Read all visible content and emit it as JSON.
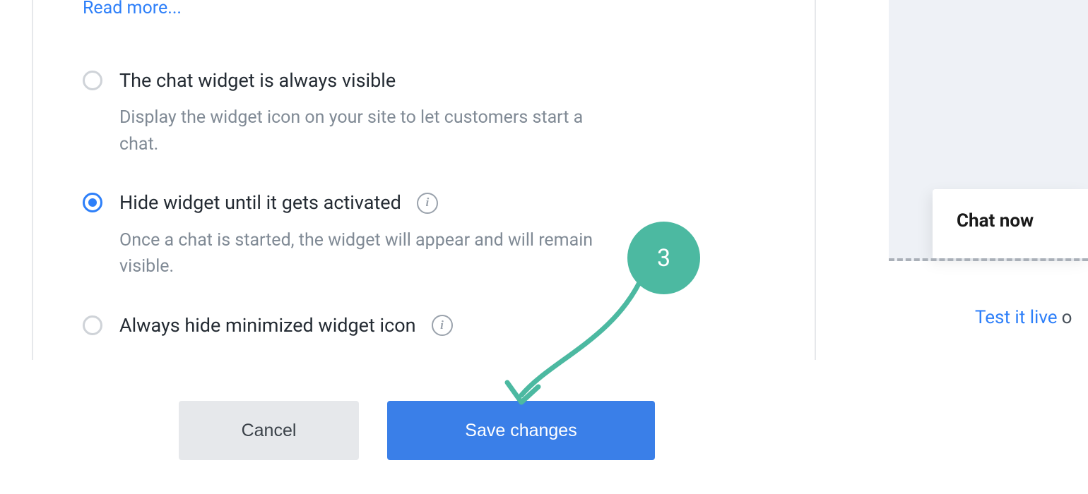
{
  "readMoreLabel": "Read more...",
  "options": [
    {
      "title": "The chat widget is always visible",
      "desc": "Display the widget icon on your site to let customers start a chat.",
      "selected": false,
      "hasInfo": false
    },
    {
      "title": "Hide widget until it gets activated",
      "desc": "Once a chat is started, the widget will appear and will remain visible.",
      "selected": true,
      "hasInfo": true
    },
    {
      "title": "Always hide minimized widget icon",
      "desc": "",
      "selected": false,
      "hasInfo": true
    }
  ],
  "chatCardTitle": "Chat now",
  "testLive": {
    "linkText": "Test it live",
    "suffix": "o"
  },
  "buttons": {
    "cancel": "Cancel",
    "save": "Save changes"
  },
  "annotation": {
    "stepNumber": "3"
  }
}
